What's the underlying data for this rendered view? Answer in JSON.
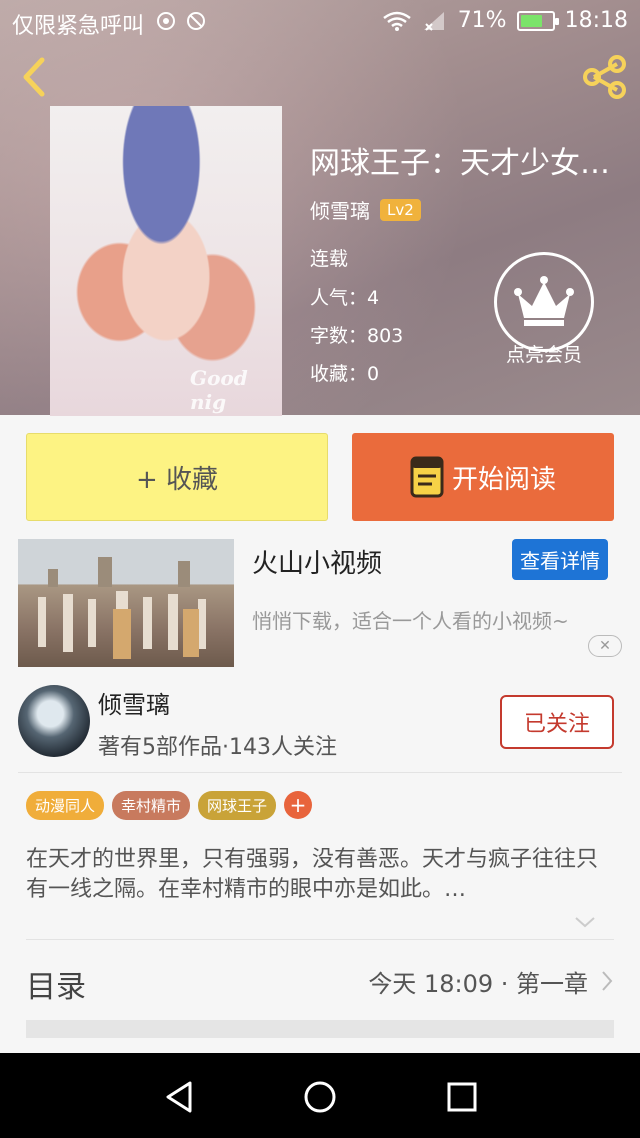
{
  "status_bar": {
    "carrier": "仅限紧急呼叫",
    "battery": "71%",
    "battery_level": 0.71,
    "time": "18:18"
  },
  "book": {
    "title": "网球王子：天才少女…",
    "author": "倾雪璃",
    "level": "Lv2",
    "status": "连载",
    "popularity": "人气：4",
    "word_count": "字数：803",
    "favorites": "收藏：0",
    "cover_text": "Good nig"
  },
  "vip": {
    "label": "点亮会员"
  },
  "actions": {
    "favorite_label": "+ 收藏",
    "read_label": "开始阅读"
  },
  "ad": {
    "title": "火山小视频",
    "detail_label": "查看详情",
    "description": "悄悄下载，适合一个人看的小视频~",
    "close_label": "✕"
  },
  "author_card": {
    "name": "倾雪璃",
    "summary": "著有5部作品·143人关注",
    "follow_label": "已关注"
  },
  "tags": [
    {
      "label": "动漫同人",
      "color": "#f0ad3a"
    },
    {
      "label": "幸村精市",
      "color": "#c87a5e"
    },
    {
      "label": "网球王子",
      "color": "#c9a338"
    }
  ],
  "tag_add_label": "+",
  "description": "在天才的世界里，只有强弱，没有善恶。天才与疯子往往只有一线之隔。在幸村精市的眼中亦是如此。…",
  "catalog": {
    "title": "目录",
    "latest": "今天 18:09 · 第一章"
  },
  "colors": {
    "accent": "#ea6b3c",
    "favorite_bg": "#fdf383",
    "follow": "#c43a2e",
    "ad_button": "#1e74d6",
    "level_badge": "#f0b23c"
  }
}
